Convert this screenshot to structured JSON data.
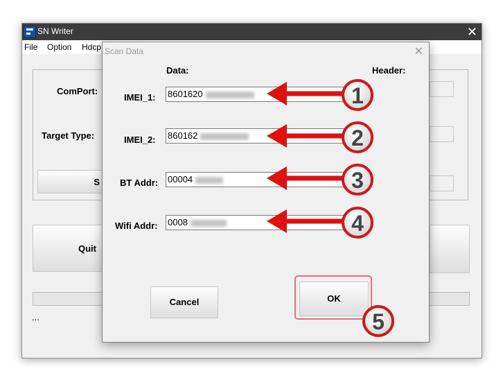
{
  "main_window": {
    "title": "SN Writer",
    "menu": [
      "File",
      "Option",
      "Hdcp"
    ],
    "labels": {
      "comport": "ComPort:",
      "target_type": "Target Type:"
    },
    "start_button_partial": "S",
    "quit_button": "Quit",
    "status_text": "..."
  },
  "dialog": {
    "title": "Scan Data",
    "col_data": "Data:",
    "col_header": "Header:",
    "fields": [
      {
        "label": "IMEI_1:",
        "value": "8601620"
      },
      {
        "label": "IMEI_2:",
        "value": "860162"
      },
      {
        "label": "BT Addr:",
        "value": "00004"
      },
      {
        "label": "Wifi Addr:",
        "value": "0008"
      }
    ],
    "cancel_button": "Cancel",
    "ok_button": "OK"
  },
  "annotations": {
    "numbers": [
      "1",
      "2",
      "3",
      "4",
      "5"
    ],
    "arrow_color": "#e01010",
    "badge_color": "#ffffff"
  }
}
